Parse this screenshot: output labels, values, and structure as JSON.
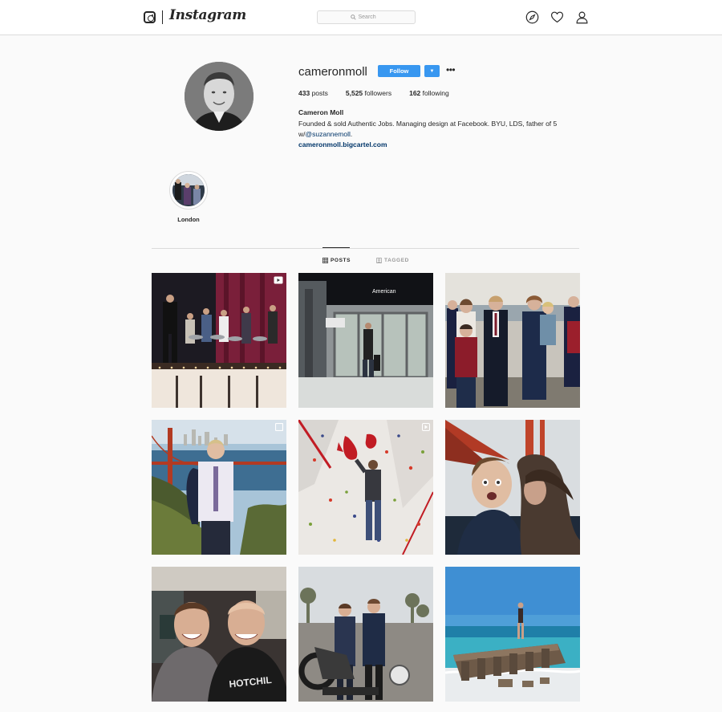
{
  "nav": {
    "logo_text": "Instagram",
    "search_placeholder": "Search",
    "icons": [
      "camera-logo-icon",
      "compass-icon",
      "heart-icon",
      "person-icon"
    ]
  },
  "profile": {
    "username": "cameronmoll",
    "follow_label": "Follow",
    "stats": {
      "posts_value": "433",
      "posts_label": "posts",
      "followers_value": "5,525",
      "followers_label": "followers",
      "following_value": "162",
      "following_label": "following"
    },
    "full_name": "Cameron Moll",
    "bio_line": "Founded & sold Authentic Jobs. Managing design at Facebook. BYU, LDS, father of 5 w/",
    "bio_mention": "@suzannemoll",
    "bio_end": ".",
    "website": "cameronmoll.bigcartel.com"
  },
  "highlights": [
    {
      "label": "London"
    }
  ],
  "tabs": [
    {
      "label": "POSTS",
      "active": true,
      "icon": "grid-icon"
    },
    {
      "label": "TAGGED",
      "active": false,
      "icon": "tag-icon"
    }
  ],
  "posts": [
    {
      "subject": "performers on a stage",
      "badge": "video-icon"
    },
    {
      "subject": "airport terminal doors",
      "badge": ""
    },
    {
      "subject": "family group photo",
      "badge": ""
    },
    {
      "subject": "man at golden gate bridge",
      "badge": "multiple-icon"
    },
    {
      "subject": "climbing wall",
      "badge": "video-icon"
    },
    {
      "subject": "selfie under bridge",
      "badge": ""
    },
    {
      "subject": "two men selfie",
      "badge": ""
    },
    {
      "subject": "two men with motorcycle",
      "badge": ""
    },
    {
      "subject": "beach pier ruins",
      "badge": ""
    }
  ],
  "colors": {
    "accent": "#3897f0",
    "link": "#003569",
    "border": "#dbdbdb",
    "background": "#fafafa"
  }
}
